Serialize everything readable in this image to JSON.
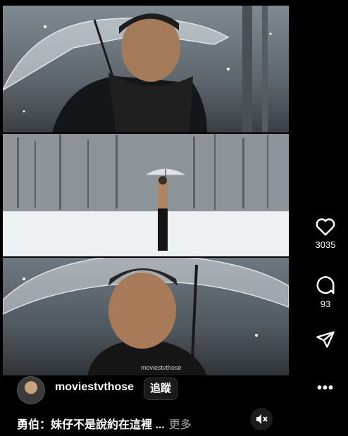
{
  "video": {
    "watermark": "moviestvthose"
  },
  "actions": {
    "likes": "3035",
    "comments": "93"
  },
  "author": {
    "username": "moviestvthose",
    "follow_label": "追蹤",
    "more_label": "•••"
  },
  "caption": {
    "text": "勇伯：妹仔不是說約在這裡 ...",
    "more_label": "更多"
  },
  "icons": {
    "like": "heart-icon",
    "comment": "comment-bubble-icon",
    "share": "send-icon",
    "mute": "speaker-muted-icon",
    "options": "more-options-icon"
  },
  "colors": {
    "background": "#000000",
    "text": "#ffffff",
    "muted_text": "#a8a8a8"
  }
}
